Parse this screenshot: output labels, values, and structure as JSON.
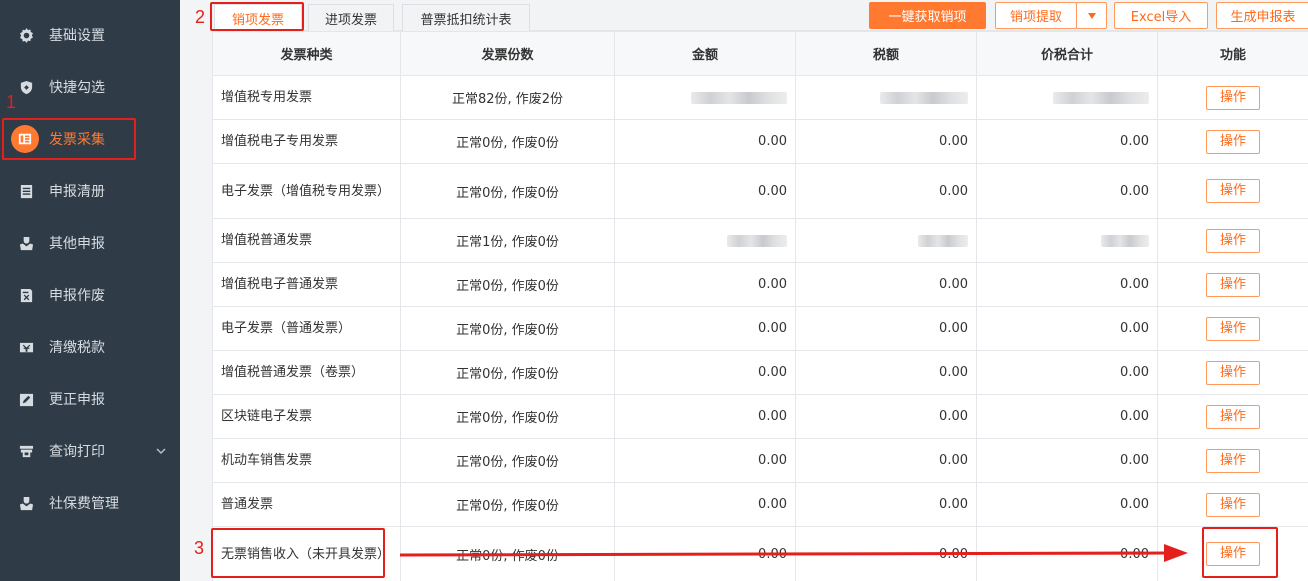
{
  "sidebar": {
    "items": [
      {
        "label": "基础设置",
        "icon": "gear-icon"
      },
      {
        "label": "快捷勾选",
        "icon": "shield-icon"
      },
      {
        "label": "发票采集",
        "icon": "invoice-icon"
      },
      {
        "label": "申报清册",
        "icon": "list-icon"
      },
      {
        "label": "其他申报",
        "icon": "hand-shield-icon"
      },
      {
        "label": "申报作废",
        "icon": "document-cancel-icon"
      },
      {
        "label": "清缴税款",
        "icon": "tax-payment-icon"
      },
      {
        "label": "更正申报",
        "icon": "edit-icon"
      },
      {
        "label": "查询打印",
        "icon": "printer-icon"
      },
      {
        "label": "社保费管理",
        "icon": "hand-shield-icon"
      }
    ]
  },
  "tabs": [
    "销项发票",
    "进项发票",
    "普票抵扣统计表"
  ],
  "toolbar": {
    "fetch_label": "一键获取销项",
    "extract_label": "销项提取",
    "excel_label": "Excel导入",
    "generate_label": "生成申报表"
  },
  "table": {
    "headers": [
      "发票种类",
      "发票份数",
      "金额",
      "税额",
      "价税合计",
      "功能"
    ],
    "action_label": "操作",
    "rows": [
      {
        "type": "增值税专用发票",
        "count": "正常82份, 作废2份",
        "amount": "",
        "tax": "",
        "total": ""
      },
      {
        "type": "增值税电子专用发票",
        "count": "正常0份, 作废0份",
        "amount": "0.00",
        "tax": "0.00",
        "total": "0.00"
      },
      {
        "type": "电子发票（增值税专用发票）",
        "count": "正常0份, 作废0份",
        "amount": "0.00",
        "tax": "0.00",
        "total": "0.00"
      },
      {
        "type": "增值税普通发票",
        "count": "正常1份, 作废0份",
        "amount": "",
        "tax": "",
        "total": ""
      },
      {
        "type": "增值税电子普通发票",
        "count": "正常0份, 作废0份",
        "amount": "0.00",
        "tax": "0.00",
        "total": "0.00"
      },
      {
        "type": "电子发票（普通发票）",
        "count": "正常0份, 作废0份",
        "amount": "0.00",
        "tax": "0.00",
        "total": "0.00"
      },
      {
        "type": "增值税普通发票（卷票）",
        "count": "正常0份, 作废0份",
        "amount": "0.00",
        "tax": "0.00",
        "total": "0.00"
      },
      {
        "type": "区块链电子发票",
        "count": "正常0份, 作废0份",
        "amount": "0.00",
        "tax": "0.00",
        "total": "0.00"
      },
      {
        "type": "机动车销售发票",
        "count": "正常0份, 作废0份",
        "amount": "0.00",
        "tax": "0.00",
        "total": "0.00"
      },
      {
        "type": "普通发票",
        "count": "正常0份, 作废0份",
        "amount": "0.00",
        "tax": "0.00",
        "total": "0.00"
      },
      {
        "type": "无票销售收入（未开具发票）",
        "count": "正常0份, 作废0份",
        "amount": "0.00",
        "tax": "0.00",
        "total": "0.00"
      }
    ]
  },
  "annotations": {
    "step1": "1",
    "step2": "2",
    "step3": "3"
  },
  "colors": {
    "accent": "#ff7a30",
    "sidebar_bg": "#2f3b47",
    "annotation": "#e3201b"
  }
}
